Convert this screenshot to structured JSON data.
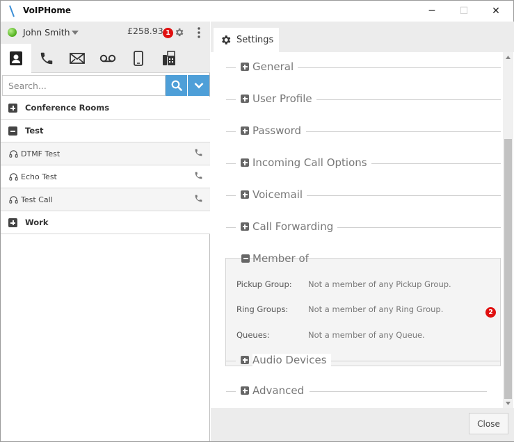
{
  "window": {
    "title": "VoIPHome",
    "controls": {
      "minimize": "─",
      "maximize": "☐",
      "close": "✕"
    }
  },
  "user": {
    "name": "John Smith",
    "balance": "£258.93",
    "status_color": "#4fae1c"
  },
  "annotations": {
    "badge_1": "1",
    "badge_2": "2"
  },
  "left_tabs": [
    {
      "icon": "contacts-icon",
      "active": true
    },
    {
      "icon": "phone-icon"
    },
    {
      "icon": "envelope-icon"
    },
    {
      "icon": "voicemail-icon"
    },
    {
      "icon": "mobile-icon"
    },
    {
      "icon": "fax-icon"
    }
  ],
  "search": {
    "placeholder": "Search...",
    "value": ""
  },
  "contacts": {
    "groups": [
      {
        "label": "Conference Rooms",
        "expanded": false
      },
      {
        "label": "Test",
        "expanded": true,
        "items": [
          "DTMF Test",
          "Echo Test",
          "Test Call"
        ]
      },
      {
        "label": "Work",
        "expanded": false
      }
    ]
  },
  "settings": {
    "tab_label": "Settings",
    "sections": [
      "General",
      "User Profile",
      "Password",
      "Incoming Call Options",
      "Voicemail",
      "Call Forwarding",
      "Member of",
      "Audio Devices",
      "Advanced"
    ],
    "member_of": {
      "rows": [
        {
          "key": "Pickup Group:",
          "value": "Not a member of any Pickup Group."
        },
        {
          "key": "Ring Groups:",
          "value": "Not a member of any Ring Group."
        },
        {
          "key": "Queues:",
          "value": "Not a member of any Queue."
        }
      ]
    },
    "close_label": "Close"
  },
  "colors": {
    "accent": "#4e9fd8",
    "badge": "#e01010"
  }
}
